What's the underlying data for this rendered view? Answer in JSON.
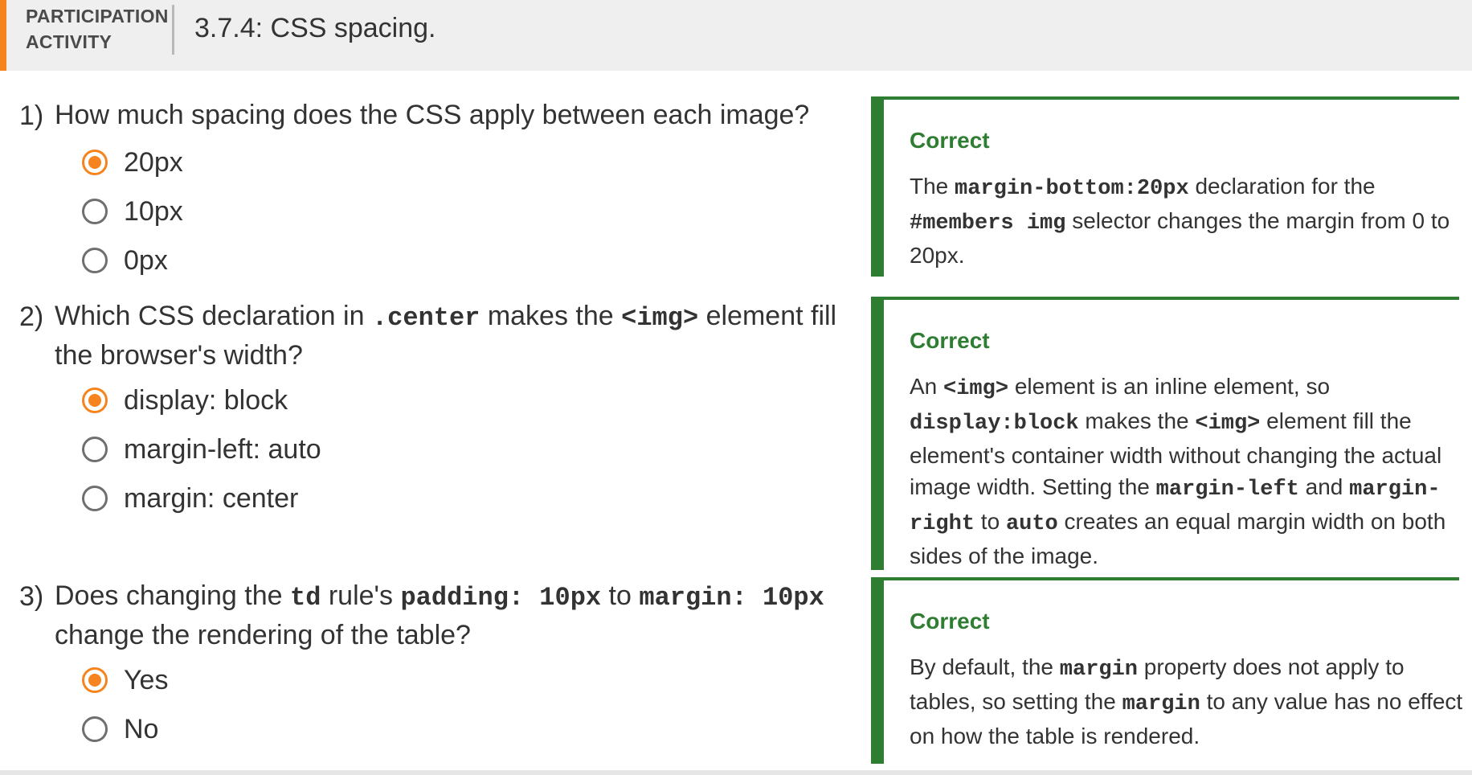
{
  "header": {
    "activity_kind_line1": "PARTICIPATION",
    "activity_kind_line2": "ACTIVITY",
    "title": "3.7.4: CSS spacing.",
    "accent_color": "#f5841f"
  },
  "questions": [
    {
      "number": "1)",
      "text": "How much spacing does the CSS apply between each image?",
      "options": [
        {
          "label": "20px",
          "selected": true
        },
        {
          "label": "10px",
          "selected": false
        },
        {
          "label": "0px",
          "selected": false
        }
      ],
      "feedback": {
        "heading": "Correct",
        "parts": [
          "The ",
          "margin-bottom:20px",
          " declaration for the ",
          "#members img",
          " selector changes the margin from 0 to 20px."
        ]
      }
    },
    {
      "number": "2)",
      "text_parts": [
        "Which CSS declaration in ",
        ".center",
        " makes the ",
        "<img>",
        " element fill the browser's width?"
      ],
      "options": [
        {
          "label": "display: block",
          "selected": true
        },
        {
          "label": "margin-left: auto",
          "selected": false
        },
        {
          "label": "margin: center",
          "selected": false
        }
      ],
      "feedback": {
        "heading": "Correct",
        "parts": [
          "An ",
          "<img>",
          " element is an inline element, so ",
          "display:block",
          " makes the ",
          "<img>",
          " element fill the element's container width without changing the actual image width. Setting the ",
          "margin-left",
          " and ",
          "margin-right",
          " to ",
          "auto",
          " creates an equal margin width on both sides of the image."
        ]
      }
    },
    {
      "number": "3)",
      "text_parts": [
        "Does changing the ",
        "td",
        " rule's ",
        "padding: 10px",
        " to ",
        "margin: 10px",
        " change the rendering of the table?"
      ],
      "options": [
        {
          "label": "Yes",
          "selected": true
        },
        {
          "label": "No",
          "selected": false
        }
      ],
      "feedback": {
        "heading": "Correct",
        "parts": [
          "By default, the ",
          "margin",
          " property does not apply to tables, so setting the ",
          "margin",
          " to any value has no effect on how the table is rendered."
        ]
      }
    }
  ],
  "colors": {
    "selected_radio": "#f5841f",
    "correct_green": "#2e7d32"
  }
}
